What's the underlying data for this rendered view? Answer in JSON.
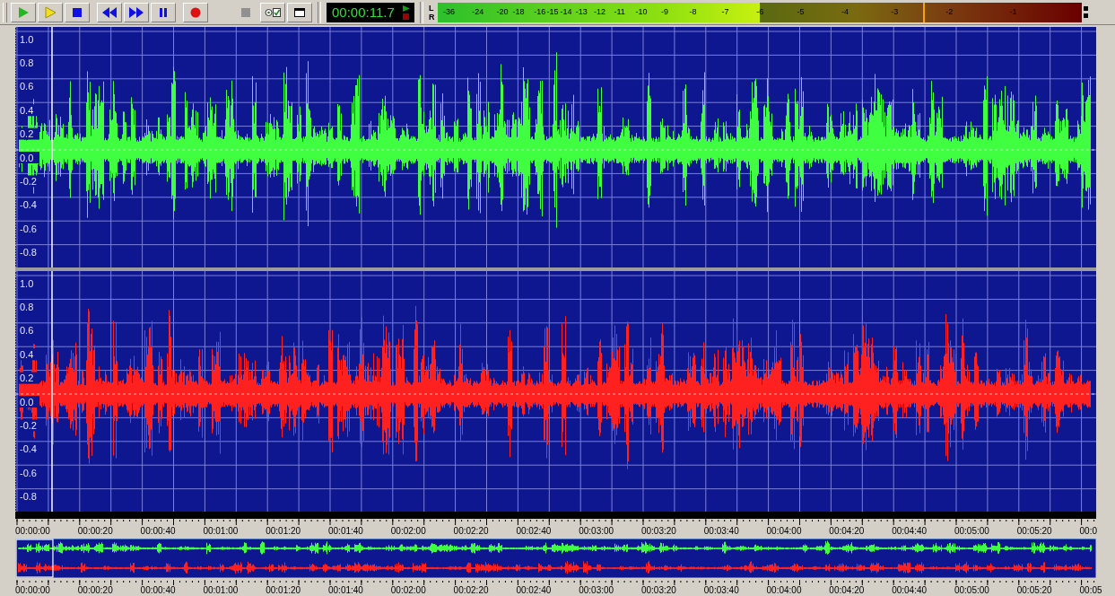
{
  "toolbar": {
    "buttons": [
      {
        "kind": "play",
        "disabled": false
      },
      {
        "kind": "play-selection",
        "disabled": false
      },
      {
        "kind": "stop",
        "disabled": false
      },
      {
        "kind": "rewind",
        "disabled": false
      },
      {
        "kind": "forward",
        "disabled": false
      },
      {
        "kind": "pause",
        "disabled": false
      },
      {
        "kind": "record",
        "disabled": false
      },
      {
        "kind": "stop-record",
        "disabled": true
      },
      {
        "kind": "loop",
        "disabled": false
      },
      {
        "kind": "window",
        "disabled": false
      }
    ]
  },
  "time_display": {
    "text": "00:00:11.7"
  },
  "meter": {
    "channels": [
      "L",
      "R"
    ],
    "scale": [
      "-36",
      "-24",
      "-20",
      "-18",
      "-16",
      "-15",
      "-14",
      "-13",
      "-12",
      "-11",
      "-10",
      "-9",
      "-8",
      "-7",
      "-6",
      "-5",
      "-4",
      "-3",
      "-2",
      "-1"
    ],
    "level": 0.5,
    "peak": {
      "level": 0.754
    }
  },
  "tracks": [
    {
      "color": "#40ff40",
      "axis": [
        "1.0",
        "0.8",
        "0.6",
        "0.4",
        "0.2",
        "0.0",
        "-0.2",
        "-0.4",
        "-0.6",
        "-0.8"
      ]
    },
    {
      "color": "#ff2020",
      "axis": [
        "1.0",
        "0.8",
        "0.6",
        "0.4",
        "0.2",
        "0.0",
        "-0.2",
        "-0.4",
        "-0.6",
        "-0.8"
      ]
    }
  ],
  "cursor": {
    "level": 0.034
  },
  "ruler": {
    "labels": [
      "00:00:00",
      "00:00:20",
      "00:00:40",
      "00:01:00",
      "00:01:20",
      "00:01:40",
      "00:02:00",
      "00:02:20",
      "00:02:40",
      "00:03:00",
      "00:03:20",
      "00:03:40",
      "00:04:00",
      "00:04:20",
      "00:04:40",
      "00:05:00",
      "00:05:20",
      "00:0"
    ]
  },
  "overview_ruler": {
    "labels": [
      "00:00:00",
      "00:00:20",
      "00:00:40",
      "00:01:00",
      "00:01:20",
      "00:01:40",
      "00:02:00",
      "00:02:20",
      "00:02:40",
      "00:03:00",
      "00:03:20",
      "00:03:40",
      "00:04:00",
      "00:04:20",
      "00:04:40",
      "00:05:00",
      "00:05:20",
      "00:05"
    ]
  }
}
